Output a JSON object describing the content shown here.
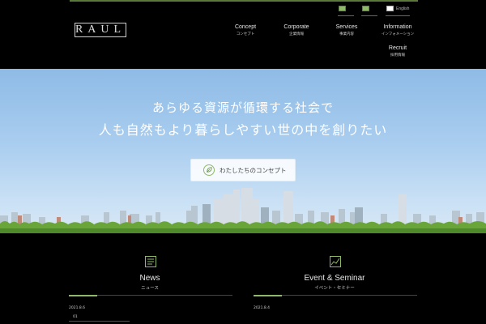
{
  "brand": {
    "logo_text": "RAUL"
  },
  "languages": [
    {
      "label": "",
      "flag": "green"
    },
    {
      "label": "",
      "flag": "green"
    },
    {
      "label": "English",
      "flag": "white"
    }
  ],
  "nav": [
    {
      "en": "Concept",
      "ja": "コンセプト"
    },
    {
      "en": "Corporate",
      "ja": "企業情報"
    },
    {
      "en": "Services",
      "ja": "事業内容"
    },
    {
      "en": "Information",
      "ja": "インフォメーション"
    },
    {
      "en": "Recruit",
      "ja": "採用情報"
    }
  ],
  "hero": {
    "line1": "あらゆる資源が循環する社会で",
    "line2": "人も自然もより暮らしやすい世の中を創りたい",
    "button_label": "わたしたちのコンセプト"
  },
  "sections": {
    "news": {
      "title": "News",
      "subtitle": "ニュース",
      "date": "2021.8.6",
      "item_number": "01"
    },
    "event": {
      "title": "Event & Seminar",
      "subtitle": "イベント・セミナー",
      "date": "2021.8.4"
    }
  },
  "colors": {
    "accent": "#8fb86a",
    "sky_top": "#8ebbe6",
    "sky_bottom": "#d8e8f5",
    "trees": "#5f9a35"
  }
}
